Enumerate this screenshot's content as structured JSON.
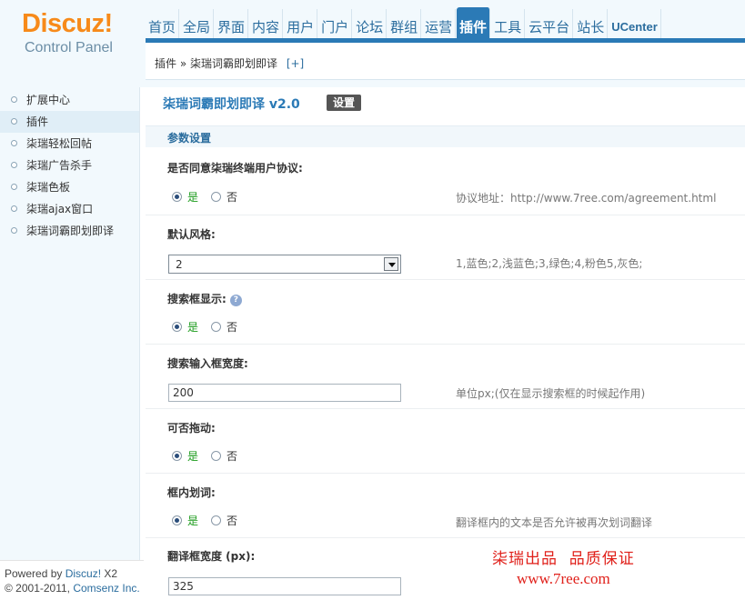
{
  "logo": {
    "main": "Discuz!",
    "sub": "Control Panel"
  },
  "nav": [
    "首页",
    "全局",
    "界面",
    "内容",
    "用户",
    "门户",
    "论坛",
    "群组",
    "运营",
    "插件",
    "工具",
    "云平台",
    "站长",
    "UCenter"
  ],
  "nav_active": "插件",
  "breadcrumb": {
    "text": "插件 » 柒瑞词霸即划即译",
    "add": "[+]"
  },
  "sidebar": {
    "items": [
      "扩展中心",
      "插件",
      "柒瑞轻松回帖",
      "柒瑞广告杀手",
      "柒瑞色板",
      "柒瑞ajax窗口",
      "柒瑞词霸即划即译"
    ],
    "active_index": 1
  },
  "footer": {
    "powered_prefix": "Powered by ",
    "powered_link": "Discuz!",
    "powered_suffix": " X2",
    "copy_prefix": "© 2001-2011, ",
    "copy_link": "Comsenz Inc."
  },
  "plugin": {
    "title": "柒瑞词霸即划即译 v2.0",
    "settings_button": "设置",
    "section": "参数设置"
  },
  "settings": {
    "agree": {
      "label": "是否同意柒瑞终端用户协议:",
      "yes": "是",
      "no": "否",
      "selected": "是",
      "hint": "协议地址：http://www.7ree.com/agreement.html"
    },
    "style": {
      "label": "默认风格:",
      "value": "2",
      "hint": "1,蓝色;2,浅蓝色;3,绿色;4,粉色5,灰色;"
    },
    "search_box": {
      "label": "搜索框显示:",
      "yes": "是",
      "no": "否",
      "selected": "是"
    },
    "search_width": {
      "label": "搜索输入框宽度:",
      "value": "200",
      "hint": "单位px;(仅在显示搜索框的时候起作用)"
    },
    "draggable": {
      "label": "可否拖动:",
      "yes": "是",
      "no": "否",
      "selected": "是"
    },
    "in_box": {
      "label": "框内划词:",
      "yes": "是",
      "no": "否",
      "selected": "是",
      "hint": "翻译框内的文本是否允许被再次划词翻译"
    },
    "trans_width": {
      "label": "翻译框宽度 (px):",
      "value": "325"
    }
  },
  "promo": {
    "line1": "柒瑞出品  品质保证",
    "line2": "www.7ree.com"
  },
  "colors": {
    "accent": "#2b7ab6",
    "logo": "#f78a1a",
    "yes_text": "#1a9a1a",
    "promo": "#e0201a"
  }
}
